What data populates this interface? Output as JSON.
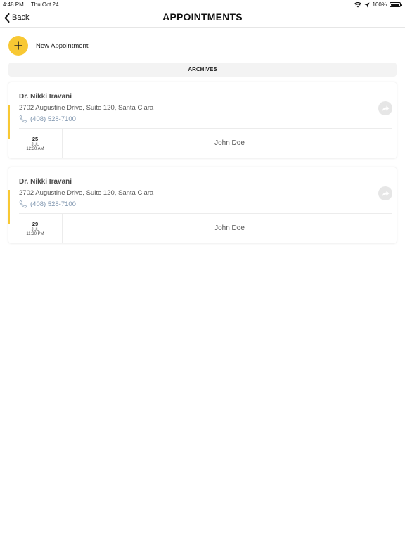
{
  "status_bar": {
    "time": "4:48 PM",
    "date": "Thu Oct 24",
    "battery": "100%"
  },
  "nav": {
    "back_label": "Back",
    "title": "APPOINTMENTS"
  },
  "new_appointment": {
    "label": "New Appointment"
  },
  "section": {
    "title": "ARCHIVES"
  },
  "appointments": [
    {
      "doctor": "Dr. Nikki Iravani",
      "address": "2702 Augustine Drive, Suite 120, Santa Clara",
      "phone": "(408) 528-7100",
      "day": "25",
      "month": "JUL",
      "time": "12:30 AM",
      "patient": "John Doe"
    },
    {
      "doctor": "Dr. Nikki Iravani",
      "address": "2702 Augustine Drive, Suite 120, Santa Clara",
      "phone": "(408) 528-7100",
      "day": "29",
      "month": "JUL",
      "time": "11:30 PM",
      "patient": "John Doe"
    }
  ],
  "colors": {
    "accent": "#f8c833",
    "phone": "#7c93ad",
    "share_bg": "#e6e6e6",
    "section_bg": "#f3f3f3"
  },
  "icons": [
    "wifi-icon",
    "location-arrow-icon",
    "battery-icon",
    "chevron-left-icon",
    "plus-icon",
    "phone-icon",
    "share-arrow-icon"
  ]
}
